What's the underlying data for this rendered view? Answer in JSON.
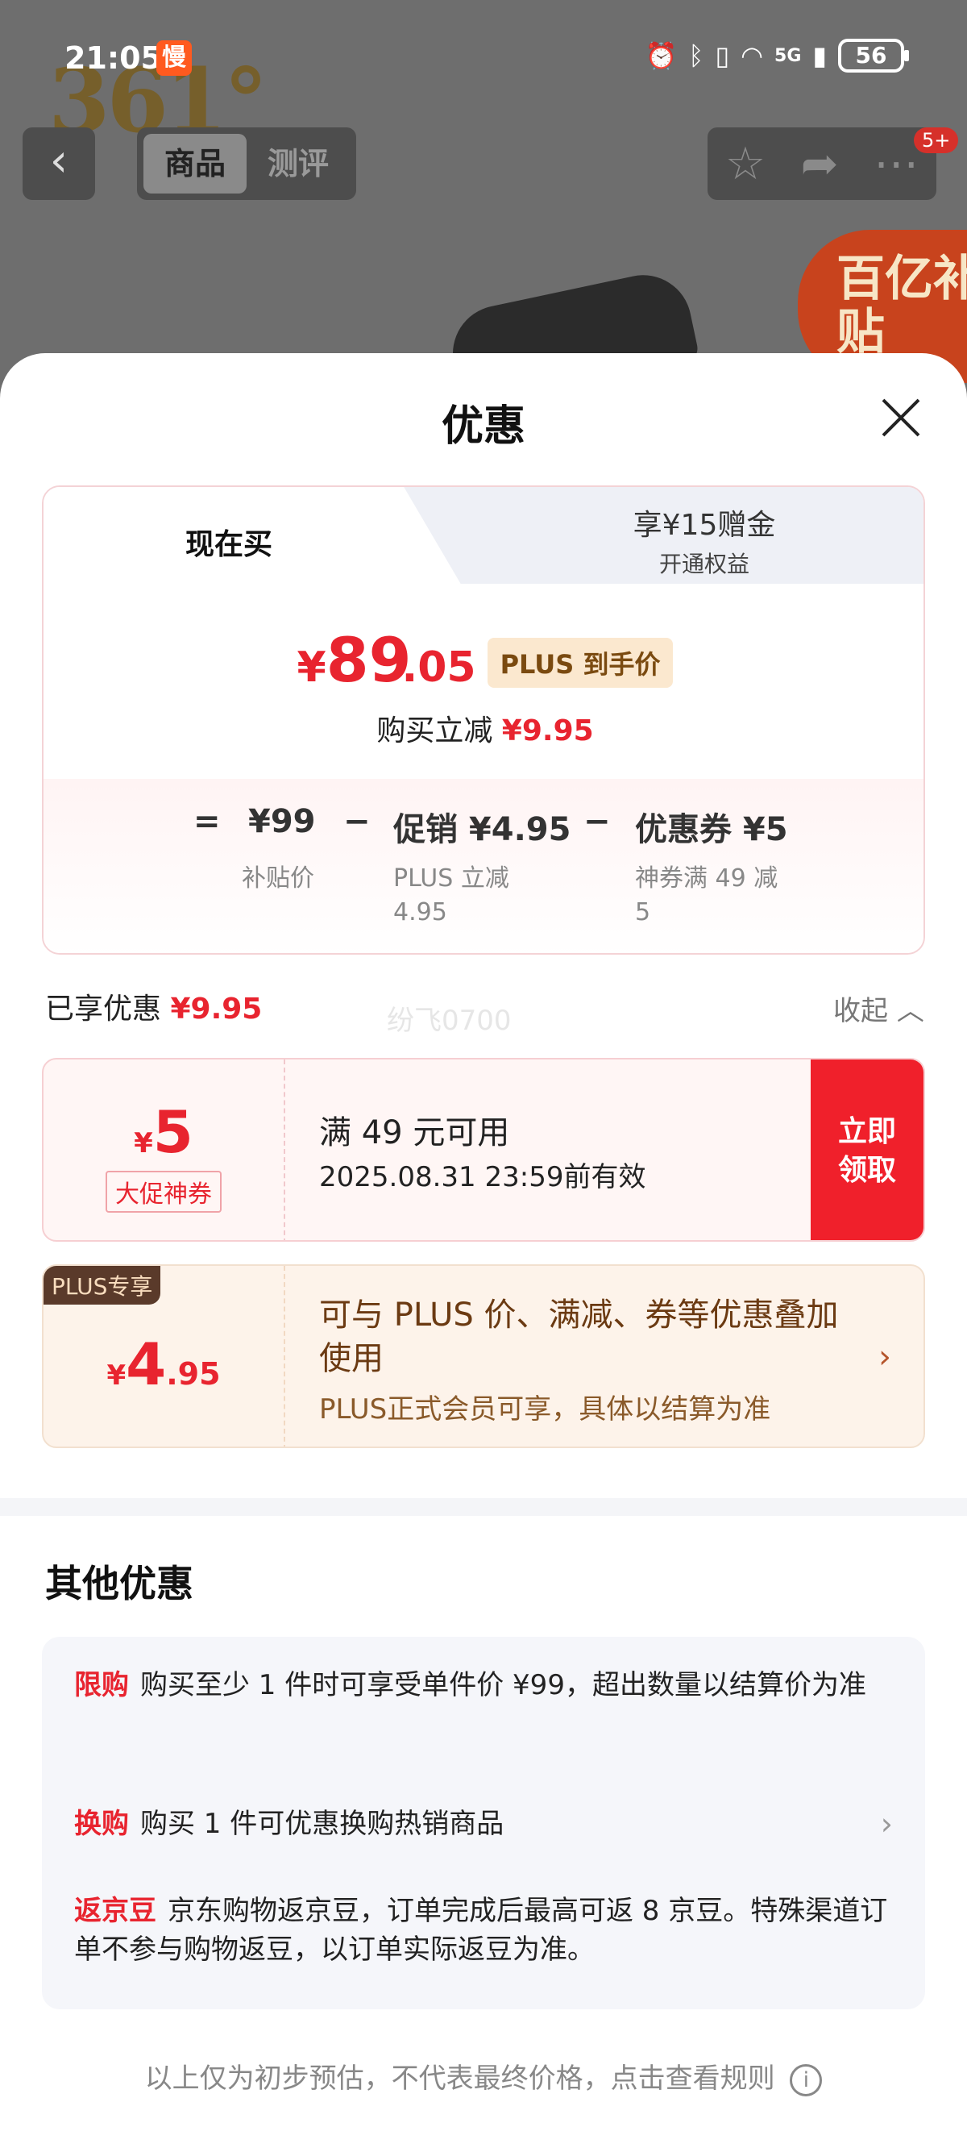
{
  "status_bar": {
    "time": "21:05",
    "slow_badge": "慢",
    "network": "5G",
    "battery": "56"
  },
  "background": {
    "logo_text": "361°",
    "nav_tabs": [
      {
        "label": "商品"
      },
      {
        "label": "测评"
      }
    ],
    "nav_badge": "5+",
    "subsidy_badge": "百亿补贴"
  },
  "sheet": {
    "title": "优惠",
    "price_tabs": {
      "now_label": "现在买",
      "alt_title": "享¥15赠金",
      "alt_sub": "开通权益"
    },
    "price": {
      "yen": "¥",
      "integer": "89",
      "decimal": ".05",
      "plus_tag": "PLUS 到手价",
      "buy_save_label": "购买立减",
      "buy_save_value": "¥9.95"
    },
    "formula": {
      "equals": "=",
      "base": "¥99",
      "minus": "−",
      "promo": "促销 ¥4.95",
      "coupon": "优惠券 ¥5",
      "base_note": "补贴价",
      "promo_note_1": "PLUS 立减",
      "promo_note_2": "4.95",
      "coupon_note_1": "神券满 49 减",
      "coupon_note_2": "5"
    },
    "enjoyed": {
      "label": "已享优惠",
      "value": "¥9.95",
      "collapse_label": "收起",
      "watermark": "纷飞0700"
    },
    "coupon": {
      "yen": "¥",
      "amount": "5",
      "tag": "大促神券",
      "condition": "满 49 元可用",
      "expiry": "2025.08.31 23:59前有效",
      "button_line1": "立即",
      "button_line2": "领取"
    },
    "plus_card": {
      "corner": "PLUS专享",
      "yen": "¥",
      "amount_int": "4",
      "amount_dec": ".95",
      "text1": "可与 PLUS 价、满减、券等优惠叠加使用",
      "text2": "PLUS正式会员可享，具体以结算为准"
    },
    "other": {
      "title": "其他优惠",
      "items": [
        {
          "tag": "限购",
          "text": "购买至少 1 件时可享受单件价 ¥99，超出数量以结算价为准"
        },
        {
          "tag": "换购",
          "text": "购买 1 件可优惠换购热销商品"
        },
        {
          "tag": "返京豆",
          "text": "京东购物返京豆，订单完成后最高可返 8 京豆。特殊渠道订单不参与购物返豆，以订单实际返豆为准。"
        }
      ]
    },
    "footer_note": "以上仅为初步预估，不代表最终价格，点击查看规则",
    "info_icon": "i"
  }
}
